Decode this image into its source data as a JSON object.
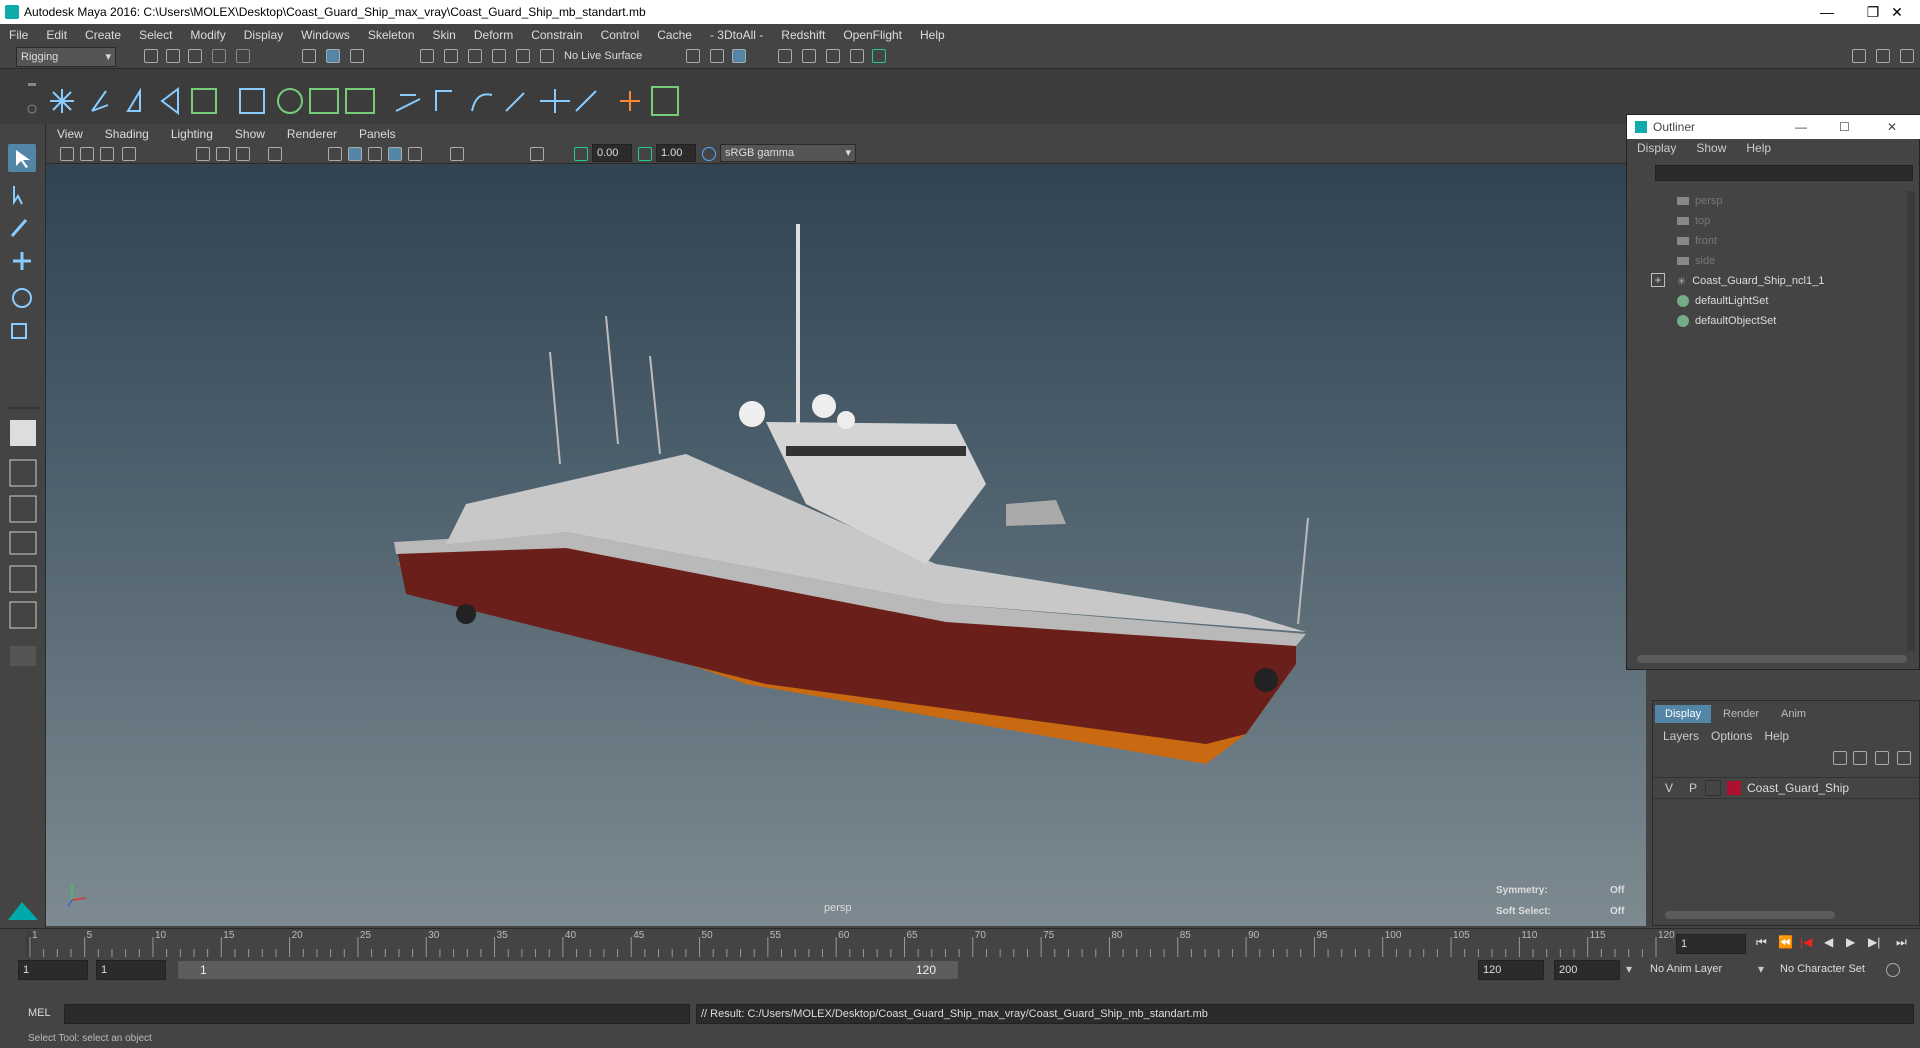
{
  "app": {
    "title": "Autodesk Maya 2016: C:\\Users\\MOLEX\\Desktop\\Coast_Guard_Ship_max_vray\\Coast_Guard_Ship_mb_standart.mb",
    "window_controls": [
      "—",
      "❐",
      "✕"
    ]
  },
  "menubar": [
    "File",
    "Edit",
    "Create",
    "Select",
    "Modify",
    "Display",
    "Windows",
    "Skeleton",
    "Skin",
    "Deform",
    "Constrain",
    "Control",
    "Cache",
    "- 3DtoAll -",
    "Redshift",
    "OpenFlight",
    "Help"
  ],
  "status_line": {
    "mode": "Rigging",
    "live_surface": "No Live Surface"
  },
  "viewport": {
    "menu": [
      "View",
      "Shading",
      "Lighting",
      "Show",
      "Renderer",
      "Panels"
    ],
    "exposure": "0.00",
    "gamma": "1.00",
    "color_space": "sRGB gamma",
    "camera_label": "persp",
    "hud": {
      "symmetry_label": "Symmetry:",
      "symmetry_value": "Off",
      "soft_select_label": "Soft Select:",
      "soft_select_value": "Off"
    }
  },
  "outliner": {
    "title": "Outliner",
    "menu": [
      "Display",
      "Show",
      "Help"
    ],
    "items": [
      {
        "label": "persp",
        "icon": "camera-icon",
        "dim": true
      },
      {
        "label": "top",
        "icon": "camera-icon",
        "dim": true
      },
      {
        "label": "front",
        "icon": "camera-icon",
        "dim": true
      },
      {
        "label": "side",
        "icon": "camera-icon",
        "dim": true
      },
      {
        "label": "Coast_Guard_Ship_ncl1_1",
        "icon": "group-icon",
        "dim": false
      },
      {
        "label": "defaultLightSet",
        "icon": "set-icon",
        "dim": false
      },
      {
        "label": "defaultObjectSet",
        "icon": "set-icon",
        "dim": false
      }
    ]
  },
  "layer_editor": {
    "tabs": [
      "Display",
      "Render",
      "Anim"
    ],
    "active_tab": "Display",
    "menu": [
      "Layers",
      "Options",
      "Help"
    ],
    "layer": {
      "v": "V",
      "p": "P",
      "name": "Coast_Guard_Ship",
      "color": "#b01030"
    }
  },
  "timeline": {
    "ticks": [
      "1",
      "5",
      "10",
      "15",
      "20",
      "25",
      "30",
      "35",
      "40",
      "45",
      "50",
      "55",
      "60",
      "65",
      "70",
      "75",
      "80",
      "85",
      "90",
      "95",
      "100",
      "105",
      "110",
      "115",
      "120"
    ],
    "current_frame": "1"
  },
  "range": {
    "start": "1",
    "anim_start": "1",
    "range_start": "1",
    "range_end": "120",
    "end": "120",
    "anim_end": "200",
    "anim_layer": "No Anim Layer",
    "character_set": "No Character Set"
  },
  "command_line": {
    "lang": "MEL",
    "result": "// Result: C:/Users/MOLEX/Desktop/Coast_Guard_Ship_max_vray/Coast_Guard_Ship_mb_standart.mb"
  },
  "help_line": "Select Tool: select an object",
  "colors": {
    "ui_bg": "#444444",
    "accent": "#5285a6",
    "hull_red": "#6b1f1a",
    "hull_orange": "#c96a12",
    "layer_red": "#b01030"
  }
}
